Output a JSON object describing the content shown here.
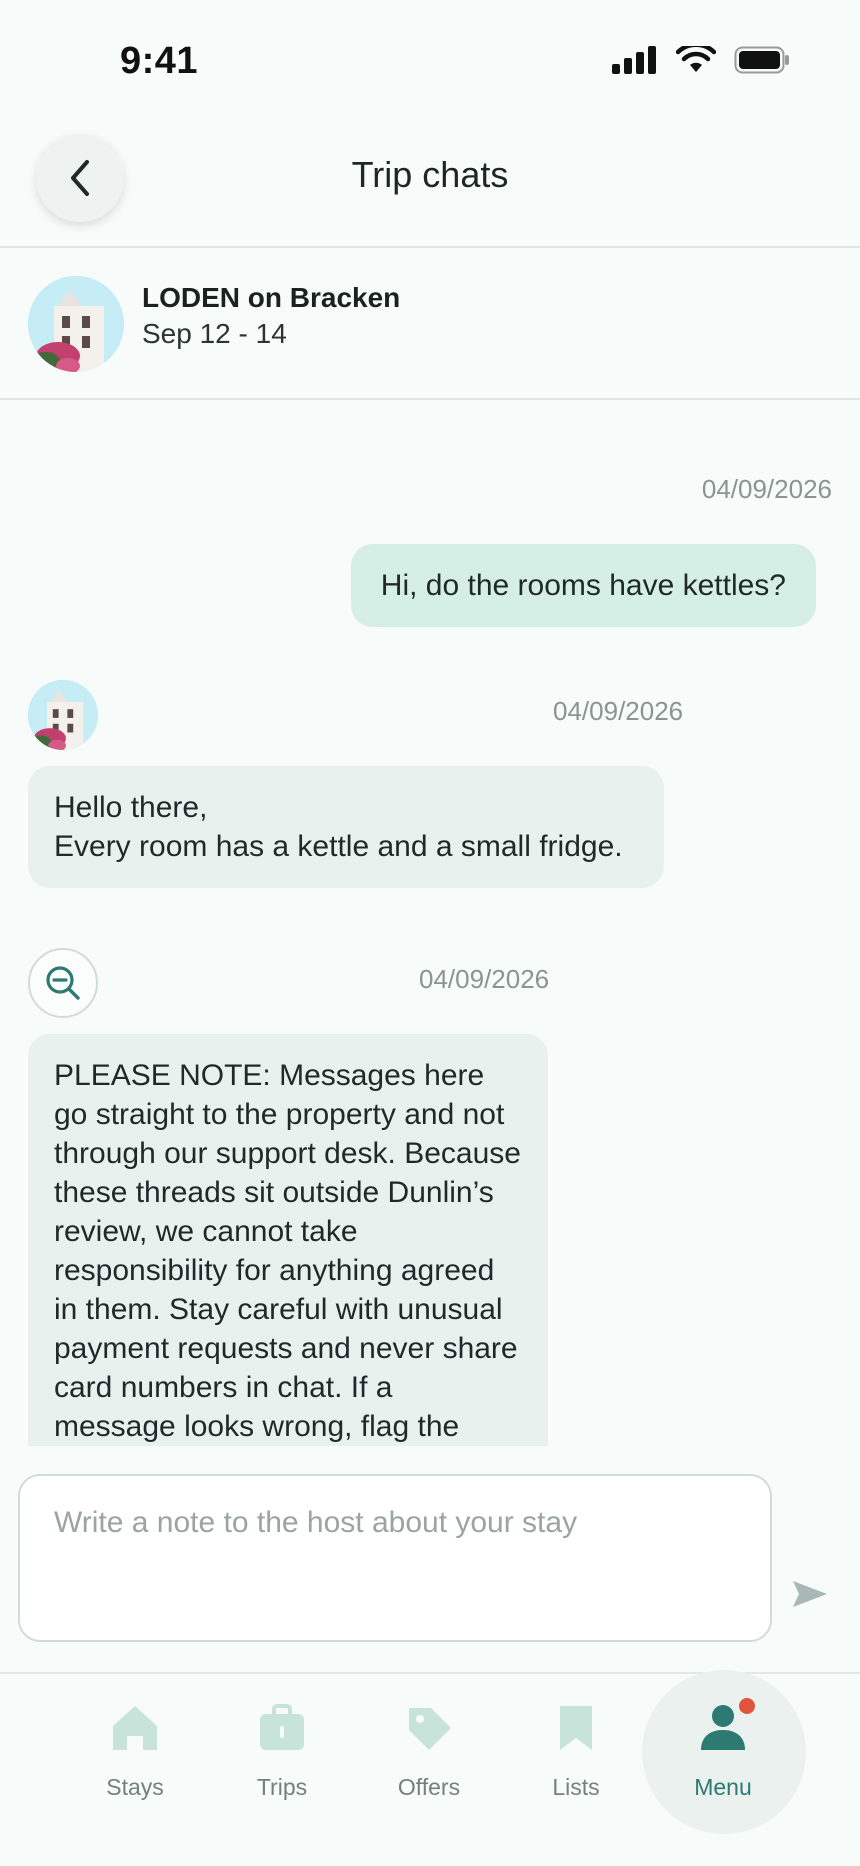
{
  "status_bar": {
    "time": "9:41",
    "icons": [
      "signal-icon",
      "wifi-icon",
      "battery-icon"
    ]
  },
  "header": {
    "title": "Trip chats",
    "back_icon": "chevron-left-icon"
  },
  "trip": {
    "property_name": "LODEN on Bracken",
    "dates": "Sep 12 - 14"
  },
  "messages": [
    {
      "direction": "outgoing",
      "timestamp": "04/09/2026",
      "text": "Hi, do the rooms have kettles?"
    },
    {
      "direction": "incoming",
      "sender": "property",
      "timestamp": "04/09/2026",
      "text": "Hello there,\nEvery room has a kettle and a small fridge."
    },
    {
      "direction": "incoming",
      "sender": "system",
      "icon": "search-minus-icon",
      "timestamp": "04/09/2026",
      "text": "PLEASE NOTE: Messages here go straight to the property and not through our support desk. Because these threads sit outside Dunlin’s review, we cannot take responsibility for anything agreed in them. Stay careful with unusual payment requests and never share card numbers in chat. If a message looks wrong, flag the"
    }
  ],
  "composer": {
    "placeholder": "Write a note to the host about your stay",
    "value": "",
    "send_icon": "send-icon"
  },
  "nav": {
    "items": [
      {
        "label": "Stays",
        "icon": "home-icon"
      },
      {
        "label": "Trips",
        "icon": "briefcase-icon"
      },
      {
        "label": "Offers",
        "icon": "tag-icon"
      },
      {
        "label": "Lists",
        "icon": "bookmark-icon"
      },
      {
        "label": "Menu",
        "icon": "person-icon",
        "active": true,
        "badge": true
      }
    ]
  },
  "colors": {
    "accent": "#2c7a72",
    "nav_icon": "#c8e3d9",
    "outgoing_bubble": "#d6efe6",
    "incoming_bubble": "#e8f1ee",
    "badge": "#e0533d"
  }
}
